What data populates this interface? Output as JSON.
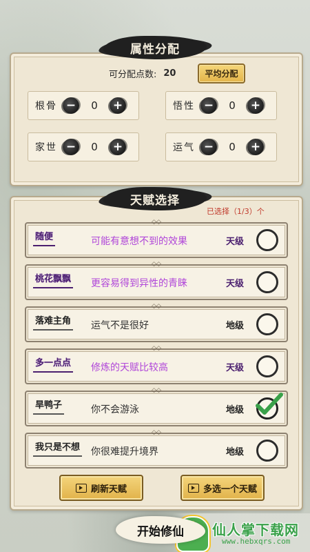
{
  "attributes_panel": {
    "title": "属性分配",
    "points_label": "可分配点数:",
    "points_value": "20",
    "auto_button": "平均分配",
    "attributes": [
      {
        "label": "根骨",
        "value": "0"
      },
      {
        "label": "悟性",
        "value": "0"
      },
      {
        "label": "家世",
        "value": "0"
      },
      {
        "label": "运气",
        "value": "0"
      }
    ],
    "minus_symbol": "−",
    "plus_symbol": "+"
  },
  "talent_panel": {
    "title": "天赋选择",
    "selected_count": "已选择（1/3）个",
    "talents": [
      {
        "name": "随便",
        "desc": "可能有意想不到的效果",
        "grade": "天级",
        "selected": false
      },
      {
        "name": "桃花飘飘",
        "desc": "更容易得到异性的青睐",
        "grade": "天级",
        "selected": false
      },
      {
        "name": "落难主角",
        "desc": "运气不是很好",
        "grade": "地级",
        "selected": false
      },
      {
        "name": "多一点点",
        "desc": "修炼的天赋比较高",
        "grade": "天级",
        "selected": false
      },
      {
        "name": "旱鸭子",
        "desc": "你不会游泳",
        "grade": "地级",
        "selected": true
      },
      {
        "name": "我只是不想",
        "desc": "你很难提升境界",
        "grade": "地级",
        "selected": false
      }
    ],
    "refresh_button": "刷新天赋",
    "extra_button": "多选一个天赋"
  },
  "start_button": "开始修仙",
  "watermark": {
    "name": "仙人掌下载网",
    "url": "www.hebxqrs.com",
    "arrow": "⬇"
  },
  "colors": {
    "tian_grade": "#4b1f6f",
    "tian_desc": "#b046d9",
    "check_green": "#3aa14a",
    "selected_count": "#c0392b"
  }
}
